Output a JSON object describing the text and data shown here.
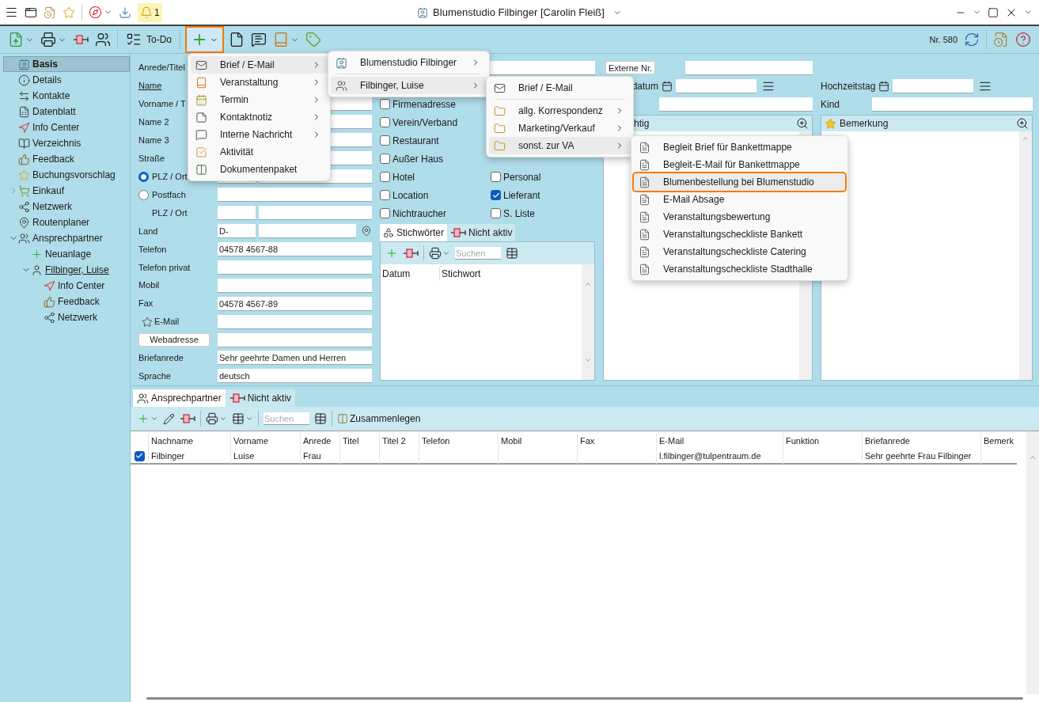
{
  "title_bar": {
    "title": "Blumenstudio Filbinger [Carolin Fleiß]",
    "notification_count": "1"
  },
  "toolbar": {
    "todo": "To-Do",
    "new_selected": true,
    "record_number": "Nr. 580"
  },
  "sidebar": {
    "items": [
      {
        "label": "Basis",
        "kind": "card",
        "selected": true
      },
      {
        "label": "Details",
        "kind": "info",
        "selected": false
      },
      {
        "label": "Kontakte",
        "kind": "contacts",
        "selected": false
      },
      {
        "label": "Datenblatt",
        "kind": "sheet",
        "selected": false
      },
      {
        "label": "Info Center",
        "kind": "compass",
        "selected": false
      },
      {
        "label": "Verzeichnis",
        "kind": "book",
        "selected": false
      },
      {
        "label": "Feedback",
        "kind": "thumb",
        "selected": false
      },
      {
        "label": "Buchungsvorschlag",
        "kind": "star",
        "selected": false
      },
      {
        "label": "Einkauf",
        "kind": "cart",
        "selected": false,
        "expanded": false
      },
      {
        "label": "Netzwerk",
        "kind": "network",
        "selected": false
      },
      {
        "label": "Routenplaner",
        "kind": "pin",
        "selected": false
      },
      {
        "label": "Ansprechpartner",
        "kind": "people",
        "selected": false,
        "expanded": true,
        "children": [
          {
            "label": "Neuanlage",
            "kind": "plus",
            "selected": false
          },
          {
            "label": "Filbinger, Luise",
            "kind": "person",
            "selected": false,
            "expanded": true,
            "children": [
              {
                "label": "Info Center",
                "kind": "compass",
                "selected": false
              },
              {
                "label": "Feedback",
                "kind": "thumb",
                "selected": false
              },
              {
                "label": "Netzwerk",
                "kind": "network",
                "selected": false
              }
            ]
          }
        ]
      }
    ]
  },
  "form": {
    "rows": [
      {
        "kind": "label",
        "label": "Anrede/Titel"
      },
      {
        "kind": "link",
        "label": "Name"
      },
      {
        "kind": "text",
        "label": "Vorname / T"
      },
      {
        "kind": "text",
        "label": "Name 2"
      },
      {
        "kind": "text",
        "label": "Name 3"
      },
      {
        "kind": "text",
        "label": "Straße"
      },
      {
        "kind": "radio_split",
        "label": "PLZ / Ort",
        "selected": true
      },
      {
        "kind": "radio",
        "label": "Postfach",
        "selected": false
      },
      {
        "kind": "split",
        "label": "PLZ / Ort"
      },
      {
        "kind": "land",
        "label": "Land",
        "value": "D-"
      },
      {
        "kind": "text",
        "label": "Telefon",
        "value": "04578 4567-88"
      },
      {
        "kind": "text",
        "label": "Telefon privat"
      },
      {
        "kind": "text",
        "label": "Mobil"
      },
      {
        "kind": "text",
        "label": "Fax",
        "value": "04578 4567-89"
      },
      {
        "kind": "star",
        "label": "E-Mail"
      },
      {
        "kind": "button",
        "label": "Webadresse"
      },
      {
        "kind": "text",
        "label": "Briefanrede",
        "value": "Sehr geehrte Damen und Herren"
      },
      {
        "kind": "text",
        "label": "Sprache",
        "value": "deutsch"
      }
    ]
  },
  "categories": {
    "left": [
      {
        "label": "Firmenadresse",
        "checked": false
      },
      {
        "label": "Verein/Verband",
        "checked": false
      },
      {
        "label": "Restaurant",
        "checked": false
      },
      {
        "label": "Außer Haus",
        "checked": false
      },
      {
        "label": "Hotel",
        "checked": false
      },
      {
        "label": "Location",
        "checked": false
      },
      {
        "label": "Nichtraucher",
        "checked": false
      }
    ],
    "right": [
      {
        "label": "Personal",
        "checked": false
      },
      {
        "label": "Lieferant",
        "checked": true
      },
      {
        "label": "S. Liste",
        "checked": false
      }
    ]
  },
  "keywords": {
    "tabs": [
      {
        "label": "Stichwörter",
        "kind": "keywords",
        "selected": true
      },
      {
        "label": "Nicht aktiv",
        "kind": "inactive",
        "selected": false
      }
    ],
    "search_placeholder": "Suchen",
    "columns": [
      "Datum",
      "Stichwort"
    ]
  },
  "details": {
    "external_number_button": "Externe Nr.",
    "date_label": "datum",
    "anniversary_label": "Hochzeitstag",
    "child_label": "Kind",
    "notes_panel_title": "htig",
    "remarks_panel_title": "Bemerkung"
  },
  "contacts": {
    "tabs": [
      {
        "label": "Ansprechpartner",
        "kind": "people",
        "selected": true
      },
      {
        "label": "Nicht aktiv",
        "kind": "inactive",
        "selected": false
      }
    ],
    "search_placeholder": "Suchen",
    "merge_button": "Zusammenlegen",
    "columns": [
      "Nachname",
      "Vorname",
      "Anrede",
      "Titel",
      "Titel 2",
      "Telefon",
      "Mobil",
      "Fax",
      "E-Mail",
      "Funktion",
      "Briefanrede",
      "Bemerk"
    ],
    "rows": [
      {
        "checked": true,
        "nachname": "Filbinger",
        "vorname": "Luise",
        "anrede": "Frau",
        "email": "l.filbinger@tulpentraum.de",
        "briefanrede": "Sehr geehrte Frau Filbinger"
      }
    ]
  },
  "new_menu": {
    "items": [
      {
        "label": "Brief / E-Mail",
        "kind": "letter",
        "submenu": true,
        "selected": true
      },
      {
        "label": "Veranstaltung",
        "kind": "event",
        "submenu": true,
        "selected": false
      },
      {
        "label": "Termin",
        "kind": "calendar",
        "submenu": true,
        "selected": false
      },
      {
        "label": "Kontaktnotiz",
        "kind": "note",
        "submenu": true,
        "selected": false
      },
      {
        "label": "Interne Nachricht",
        "kind": "message",
        "submenu": true,
        "selected": false
      },
      {
        "label": "Aktivität",
        "kind": "activity",
        "submenu": false,
        "selected": false
      },
      {
        "label": "Dokumentenpaket",
        "kind": "package",
        "submenu": false,
        "selected": false
      }
    ]
  },
  "recipient_menu": {
    "items": [
      {
        "label": "Blumenstudio Filbinger",
        "kind": "card",
        "submenu": true,
        "selected": false,
        "separator_after": true
      },
      {
        "label": "Filbinger, Luise",
        "kind": "people",
        "submenu": true,
        "selected": true,
        "separator_after": false
      }
    ]
  },
  "folder_menu": {
    "items": [
      {
        "label": "Brief / E-Mail",
        "kind": "letter",
        "submenu": false,
        "selected": false,
        "separator_after": true
      },
      {
        "label": "allg. Korrespondenz",
        "kind": "folder",
        "submenu": true,
        "selected": false,
        "separator_after": false
      },
      {
        "label": "Marketing/Verkauf",
        "kind": "folder",
        "submenu": true,
        "selected": false,
        "separator_after": false
      },
      {
        "label": "sonst. zur VA",
        "kind": "folder",
        "submenu": true,
        "selected": true,
        "separator_after": false
      }
    ]
  },
  "template_menu": {
    "items": [
      {
        "label": "Begleit Brief für Bankettmappe",
        "kind": "template",
        "submenu": false,
        "selected": false
      },
      {
        "label": "Begleit-E-Mail für Bankettmappe",
        "kind": "template",
        "submenu": false,
        "selected": false
      },
      {
        "label": "Blumenbestellung bei Blumenstudio",
        "kind": "template",
        "submenu": false,
        "selected": true
      },
      {
        "label": "E-Mail Absage",
        "kind": "template",
        "submenu": false,
        "selected": false
      },
      {
        "label": "Veranstaltungsbewertung",
        "kind": "template",
        "submenu": false,
        "selected": false
      },
      {
        "label": "Veranstaltungscheckliste Bankett",
        "kind": "template",
        "submenu": false,
        "selected": false
      },
      {
        "label": "Veranstaltungscheckliste Catering",
        "kind": "template",
        "submenu": false,
        "selected": false
      },
      {
        "label": "Veranstaltungscheckliste Stadthalle",
        "kind": "template",
        "submenu": false,
        "selected": false
      }
    ]
  }
}
